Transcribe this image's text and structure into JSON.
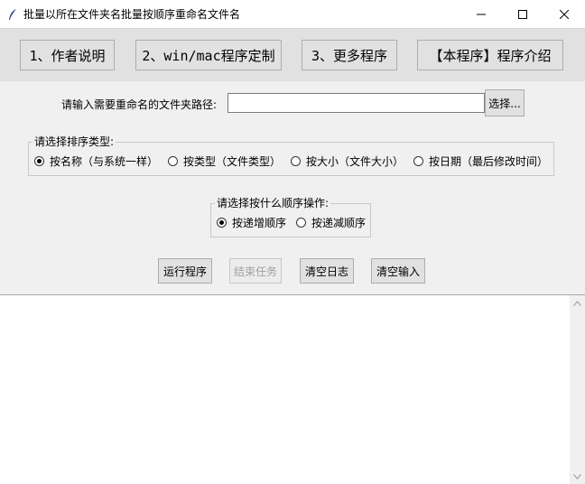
{
  "window": {
    "title": "批量以所在文件夹名批量按顺序重命名文件名",
    "icons": {
      "app": "feather-icon",
      "minimize": "minimize-icon",
      "maximize": "maximize-icon",
      "close": "close-icon"
    }
  },
  "toolbar": {
    "buttons": [
      {
        "label": "1、作者说明"
      },
      {
        "label": "2、win/mac程序定制"
      },
      {
        "label": "3、更多程序"
      },
      {
        "label": "【本程序】程序介绍"
      }
    ]
  },
  "path": {
    "label": "请输入需要重命名的文件夹路径:",
    "value": "",
    "placeholder": "",
    "browse_label": "选择..."
  },
  "sort_type": {
    "legend": "请选择排序类型:",
    "options": [
      {
        "label": "按名称（与系统一样）",
        "selected": true
      },
      {
        "label": "按类型（文件类型）",
        "selected": false
      },
      {
        "label": "按大小（文件大小）",
        "selected": false
      },
      {
        "label": "按日期（最后修改时间）",
        "selected": false
      }
    ]
  },
  "order": {
    "legend": "请选择按什么顺序操作:",
    "options": [
      {
        "label": "按递增顺序",
        "selected": true
      },
      {
        "label": "按递减顺序",
        "selected": false
      }
    ]
  },
  "actions": {
    "run": "运行程序",
    "stop": "结束任务",
    "clear_log": "清空日志",
    "clear_input": "清空输入"
  },
  "log": {
    "text": ""
  },
  "colors": {
    "toolbar_bg": "#e1e1e1",
    "panel_bg": "#f0f0f0",
    "disabled_text": "#a0a0a0"
  }
}
